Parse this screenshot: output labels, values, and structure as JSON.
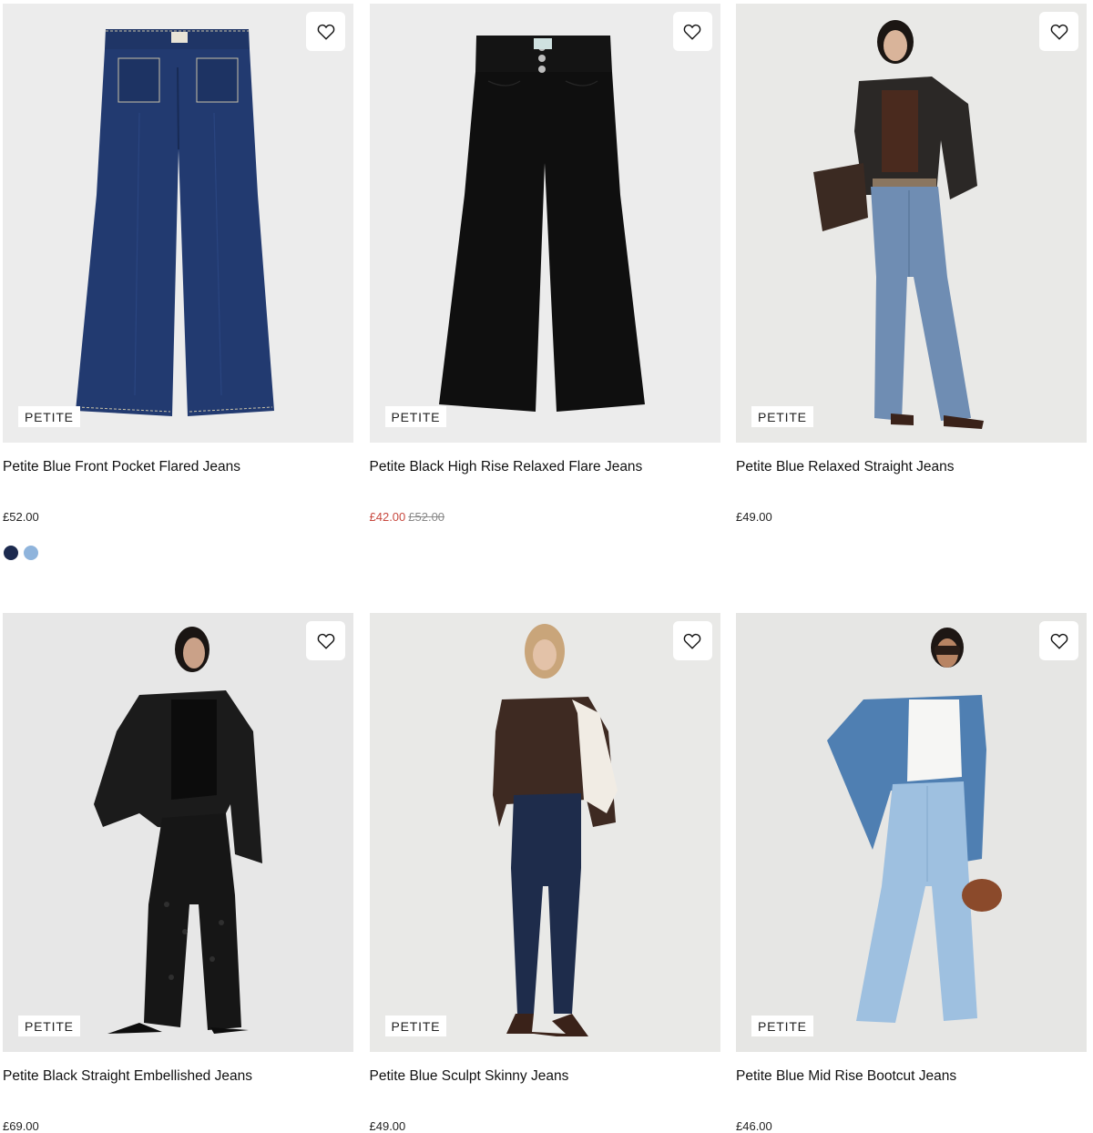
{
  "colors": {
    "sale_price": "#c8493f",
    "was_price": "#888888",
    "badge_bg": "#ffffff",
    "image_bg": "#ececec"
  },
  "products": [
    {
      "title": "Petite Blue Front Pocket Flared Jeans",
      "badge": "PETITE",
      "price": "£52.00",
      "swatches": [
        "#1c2a4f",
        "#8fb4dc"
      ],
      "image": "blue-flared-jeans-flatlay",
      "icon": "heart-icon"
    },
    {
      "title": "Petite Black High Rise Relaxed Flare Jeans",
      "badge": "PETITE",
      "sale_price": "£42.00",
      "was_price": "£52.00",
      "image": "black-flare-jeans-flatlay",
      "icon": "heart-icon"
    },
    {
      "title": "Petite Blue Relaxed Straight Jeans",
      "badge": "PETITE",
      "price": "£49.00",
      "image": "model-blue-straight-jeans",
      "icon": "heart-icon"
    },
    {
      "title": "Petite Black Straight Embellished Jeans",
      "badge": "PETITE",
      "price": "£69.00",
      "image": "model-black-embellished-jeans",
      "icon": "heart-icon"
    },
    {
      "title": "Petite Blue Sculpt Skinny Jeans",
      "badge": "PETITE",
      "price": "£49.00",
      "image": "model-blue-skinny-jeans",
      "icon": "heart-icon"
    },
    {
      "title": "Petite Blue Mid Rise Bootcut Jeans",
      "badge": "PETITE",
      "price": "£46.00",
      "image": "model-blue-bootcut-jeans",
      "icon": "heart-icon"
    }
  ]
}
